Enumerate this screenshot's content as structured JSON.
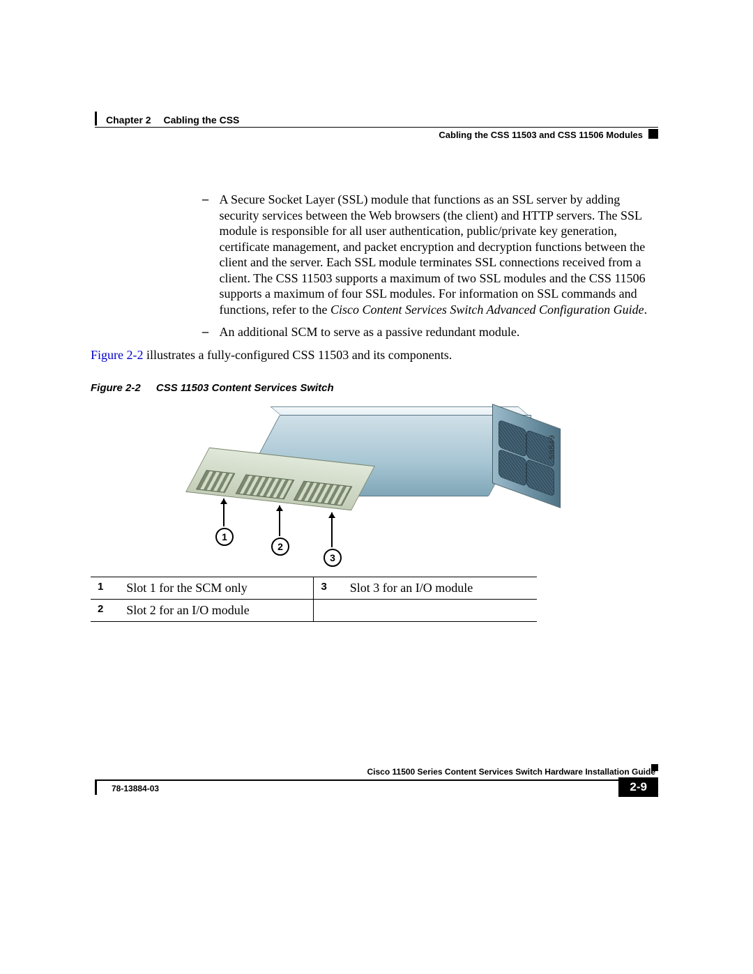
{
  "header": {
    "chapter_label": "Chapter 2",
    "chapter_title": "Cabling the CSS",
    "section_title": "Cabling the CSS 11503 and CSS 11506 Modules"
  },
  "content": {
    "bullet1_text": "A Secure Socket Layer (SSL) module that functions as an SSL server by adding security services between the Web browsers (the client) and HTTP servers. The SSL module is responsible for all user authentication, public/private key generation, certificate management, and packet encryption and decryption functions between the client and the server. Each SSL module terminates SSL connections received from a client. The CSS 11503 supports a maximum of two SSL modules and the CSS 11506 supports a maximum of four SSL modules. For information on SSL commands and functions, refer to the ",
    "bullet1_italic": "Cisco Content Services Switch Advanced Configuration Guide",
    "bullet1_period": ".",
    "bullet2": "An additional SCM to serve as a passive redundant module.",
    "figure_link": "Figure 2-2",
    "figure_intro_rest": " illustrates a fully-configured CSS 11503 and its components.",
    "figure_caption_num": "Figure 2-2",
    "figure_caption_title": "CSS 11503 Content Services Switch",
    "image_number": "59549",
    "callouts": {
      "c1": "1",
      "c2": "2",
      "c3": "3"
    },
    "table": {
      "r1n": "1",
      "r1d": "Slot 1 for the SCM only",
      "r1n2": "3",
      "r1d2": "Slot 3 for an I/O module",
      "r2n": "2",
      "r2d": "Slot 2 for an I/O module"
    }
  },
  "footer": {
    "doc_title": "Cisco 11500 Series Content Services Switch Hardware Installation Guide",
    "doc_id": "78-13884-03",
    "page_num": "2-9"
  }
}
